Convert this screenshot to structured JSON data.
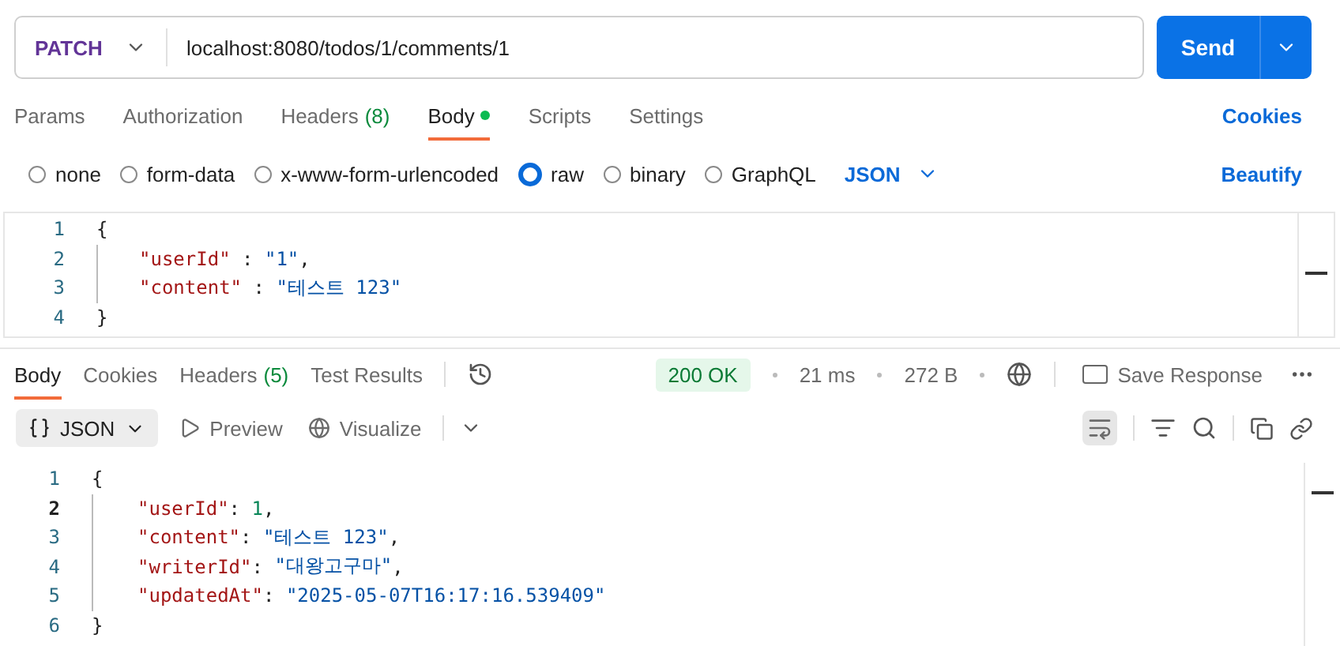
{
  "request": {
    "method": "PATCH",
    "url": "localhost:8080/todos/1/comments/1",
    "send": "Send"
  },
  "request_tabs": [
    {
      "label": "Params",
      "selected": false
    },
    {
      "label": "Authorization",
      "selected": false
    },
    {
      "label": "Headers",
      "count": "(8)",
      "selected": false
    },
    {
      "label": "Body",
      "selected": true,
      "dot": true
    },
    {
      "label": "Scripts",
      "selected": false
    },
    {
      "label": "Settings",
      "selected": false
    }
  ],
  "cookies_link": "Cookies",
  "body_types": [
    {
      "label": "none",
      "selected": false
    },
    {
      "label": "form-data",
      "selected": false
    },
    {
      "label": "x-www-form-urlencoded",
      "selected": false
    },
    {
      "label": "raw",
      "selected": true
    },
    {
      "label": "binary",
      "selected": false
    },
    {
      "label": "GraphQL",
      "selected": false
    }
  ],
  "format": "JSON",
  "beautify": "Beautify",
  "request_body": [
    {
      "number": "1",
      "tokens": [
        {
          "kind": "punct",
          "text": "{"
        }
      ]
    },
    {
      "number": "2",
      "tokens": [
        {
          "kind": "key",
          "text": "\"userId\""
        },
        {
          "kind": "punct",
          "text": " : "
        },
        {
          "kind": "string",
          "text": "\"1\""
        },
        {
          "kind": "punct",
          "text": ","
        }
      ]
    },
    {
      "number": "3",
      "tokens": [
        {
          "kind": "key",
          "text": "\"content\""
        },
        {
          "kind": "punct",
          "text": " : "
        },
        {
          "kind": "string",
          "text": "\"테스트 123\""
        }
      ]
    },
    {
      "number": "4",
      "tokens": [
        {
          "kind": "punct",
          "text": "}"
        }
      ]
    }
  ],
  "response_tabs": [
    {
      "label": "Body",
      "selected": true
    },
    {
      "label": "Cookies",
      "selected": false
    },
    {
      "label": "Headers",
      "count": "(5)",
      "selected": false
    },
    {
      "label": "Test Results",
      "selected": false
    }
  ],
  "status": {
    "code": "200 OK",
    "time": "21 ms",
    "size": "272 B",
    "save": "Save Response"
  },
  "view": {
    "format": "JSON",
    "preview": "Preview",
    "visualize": "Visualize",
    "wrap_on": true
  },
  "response_body": [
    {
      "number": "1",
      "active": false,
      "tokens": [
        {
          "kind": "punct",
          "text": "{"
        }
      ]
    },
    {
      "number": "2",
      "active": true,
      "tokens": [
        {
          "kind": "key",
          "text": "\"userId\""
        },
        {
          "kind": "punct",
          "text": ": "
        },
        {
          "kind": "number",
          "text": "1"
        },
        {
          "kind": "punct",
          "text": ","
        }
      ]
    },
    {
      "number": "3",
      "active": false,
      "tokens": [
        {
          "kind": "key",
          "text": "\"content\""
        },
        {
          "kind": "punct",
          "text": ": "
        },
        {
          "kind": "string",
          "text": "\"테스트 123\""
        },
        {
          "kind": "punct",
          "text": ","
        }
      ]
    },
    {
      "number": "4",
      "active": false,
      "tokens": [
        {
          "kind": "key",
          "text": "\"writerId\""
        },
        {
          "kind": "punct",
          "text": ": "
        },
        {
          "kind": "string",
          "text": "\"대왕고구마\""
        },
        {
          "kind": "punct",
          "text": ","
        }
      ]
    },
    {
      "number": "5",
      "active": false,
      "tokens": [
        {
          "kind": "key",
          "text": "\"updatedAt\""
        },
        {
          "kind": "punct",
          "text": ": "
        },
        {
          "kind": "string",
          "text": "\"2025-05-07T16:17:16.539409\""
        }
      ]
    },
    {
      "number": "6",
      "active": false,
      "tokens": [
        {
          "kind": "punct",
          "text": "}"
        }
      ]
    }
  ]
}
